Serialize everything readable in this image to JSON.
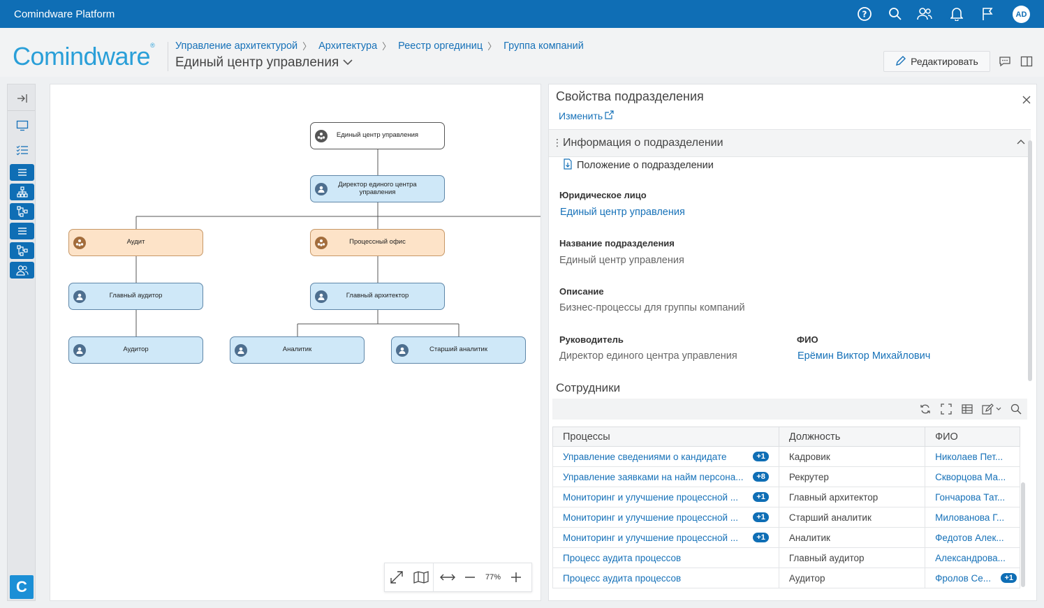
{
  "app": {
    "title": "Comindware Platform",
    "logo_text": "Comindware",
    "user_initials": "AD"
  },
  "topbar_icons": [
    "help-icon",
    "search-icon",
    "users-icon",
    "bell-icon",
    "flag-icon"
  ],
  "breadcrumb": [
    "Управление архитектурой",
    "Архитектура",
    "Реестр оргединиц",
    "Группа компаний"
  ],
  "page_title": "Единый центр управления",
  "edit_button": "Редактировать",
  "diagram": {
    "nodes": [
      {
        "id": "root",
        "label": "Единый центр управления",
        "kind": "root"
      },
      {
        "id": "director",
        "label": "Директор единого центра управления",
        "kind": "position"
      },
      {
        "id": "audit",
        "label": "Аудит",
        "kind": "dept"
      },
      {
        "id": "procoffice",
        "label": "Процессный офис",
        "kind": "dept"
      },
      {
        "id": "mainauditor",
        "label": "Главный аудитор",
        "kind": "position"
      },
      {
        "id": "mainarch",
        "label": "Главный архитектор",
        "kind": "position"
      },
      {
        "id": "auditor",
        "label": "Аудитор",
        "kind": "position"
      },
      {
        "id": "analyst",
        "label": "Аналитик",
        "kind": "position"
      },
      {
        "id": "senioranalyst",
        "label": "Старший аналитик",
        "kind": "position"
      }
    ],
    "zoom": "77%"
  },
  "props": {
    "title": "Свойства подразделения",
    "change_link": "Изменить",
    "section_title": "Информация о подразделении",
    "doc_link": "Положение о подразделении",
    "legal_entity_label": "Юридическое лицо",
    "legal_entity_value": "Единый центр управления",
    "name_label": "Название подразделения",
    "name_value": "Единый центр управления",
    "desc_label": "Описание",
    "desc_value": "Бизнес-процессы для группы компаний",
    "head_label": "Руководитель",
    "head_value": "Директор единого центра управления",
    "fio_label": "ФИО",
    "fio_value": "Ерёмин Виктор Михайлович",
    "employees_title": "Сотрудники"
  },
  "employees": {
    "columns": [
      "Процессы",
      "Должность",
      "ФИО"
    ],
    "rows": [
      {
        "process": "Управление сведениями о кандидате",
        "process_badge": "+1",
        "position": "Кадровик",
        "fio": "Николаев Пет...",
        "fio_badge": ""
      },
      {
        "process": "Управление заявками на найм персона...",
        "process_badge": "+8",
        "position": "Рекрутер",
        "fio": "Скворцова Ма...",
        "fio_badge": ""
      },
      {
        "process": "Мониторинг и улучшение процессной ...",
        "process_badge": "+1",
        "position": "Главный архитектор",
        "fio": "Гончарова Тат...",
        "fio_badge": ""
      },
      {
        "process": "Мониторинг и улучшение процессной ...",
        "process_badge": "+1",
        "position": "Старший аналитик",
        "fio": "Милованова Г...",
        "fio_badge": ""
      },
      {
        "process": "Мониторинг и улучшение процессной ...",
        "process_badge": "+1",
        "position": "Аналитик",
        "fio": "Федотов Алек...",
        "fio_badge": ""
      },
      {
        "process": "Процесс аудита процессов",
        "process_badge": "",
        "position": "Главный аудитор",
        "fio": "Александрова...",
        "fio_badge": ""
      },
      {
        "process": "Процесс аудита процессов",
        "process_badge": "",
        "position": "Аудитор",
        "fio": "Фролов Се...",
        "fio_badge": "+1"
      }
    ]
  },
  "colors": {
    "primary": "#0f6eb5",
    "link": "#1671b8",
    "position_fill": "#cfe8f8",
    "dept_fill": "#fde3c8"
  }
}
